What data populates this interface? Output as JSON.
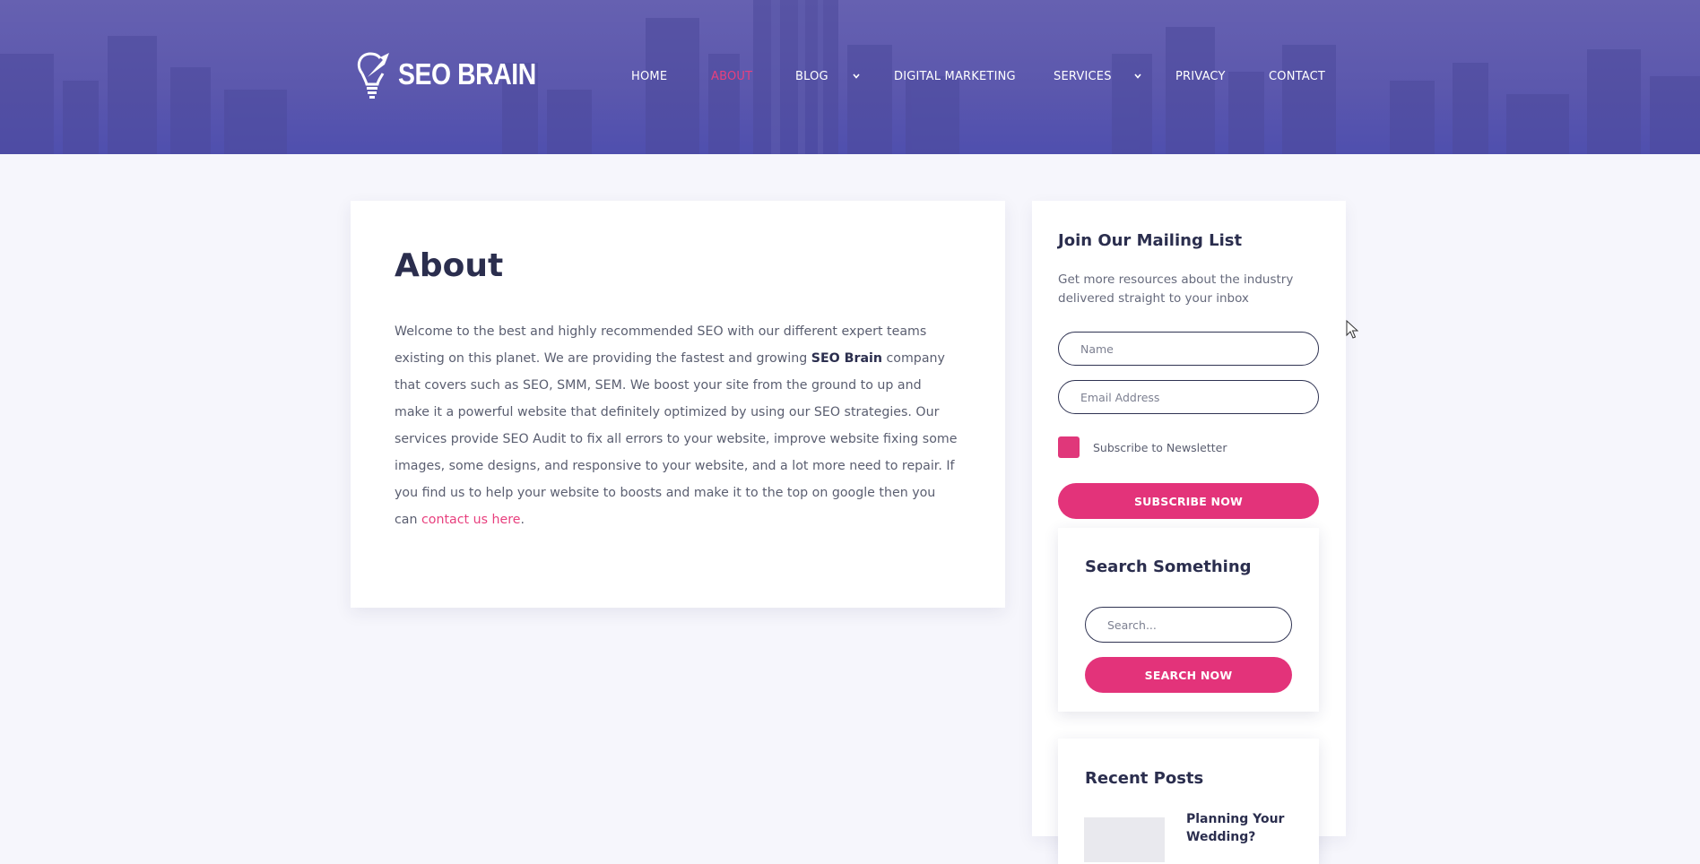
{
  "brand": {
    "name": "SEO BRAIN"
  },
  "nav": [
    {
      "label": "HOME",
      "active": false
    },
    {
      "label": "ABOUT",
      "active": true
    },
    {
      "label": "BLOG",
      "active": false,
      "dropdown": true
    },
    {
      "label": "DIGITAL MARKETING",
      "active": false
    },
    {
      "label": "SERVICES",
      "active": false,
      "dropdown": true
    },
    {
      "label": "PRIVACY",
      "active": false
    },
    {
      "label": "CONTACT",
      "active": false
    }
  ],
  "main": {
    "title": "About",
    "p1": "Welcome to the best and highly recommended SEO with our different expert teams existing on this planet. We are providing the fastest and growing ",
    "brand_bold": "SEO Brain",
    "p2": " company that covers such as SEO, SMM, SEM. We boost your site from the ground to up and make it a powerful website that definitely optimized by using our SEO strategies. Our services provide SEO Audit to fix all errors to your website, improve website fixing some images, some designs, and responsive to your website, and a lot more need to repair. If you find us to help your website to boosts and make it to the top on google then you can ",
    "link": "contact us here",
    "p3": "."
  },
  "mailing": {
    "title": "Join Our Mailing List",
    "description": "Get more resources about the industry delivered straight to your inbox",
    "name_placeholder": "Name",
    "email_placeholder": "Email Address",
    "checkbox_label": "Subscribe to Newsletter",
    "button": "SUBSCRIBE NOW"
  },
  "search": {
    "title": "Search Something",
    "placeholder": "Search...",
    "button": "SEARCH NOW"
  },
  "recent": {
    "title": "Recent Posts",
    "posts": [
      {
        "title": "Planning Your Wedding?"
      }
    ]
  },
  "colors": {
    "accent": "#e3337a",
    "header": "#5c58ad",
    "heading": "#2b2e4e",
    "background": "#f6f6fc"
  },
  "icons": [
    "lightbulb-rocket-logo-icon",
    "chevron-down-icon",
    "mouse-cursor-icon"
  ]
}
